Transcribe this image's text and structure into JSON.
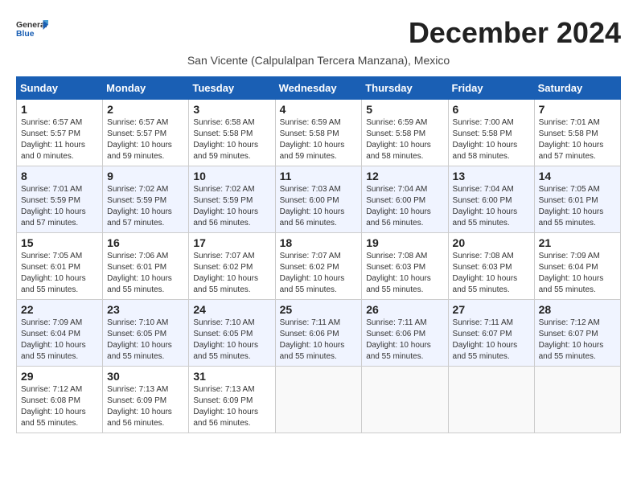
{
  "header": {
    "logo_general": "General",
    "logo_blue": "Blue",
    "month_title": "December 2024",
    "subtitle": "San Vicente (Calpulalpan Tercera Manzana), Mexico"
  },
  "days_of_week": [
    "Sunday",
    "Monday",
    "Tuesday",
    "Wednesday",
    "Thursday",
    "Friday",
    "Saturday"
  ],
  "weeks": [
    [
      {
        "day": "1",
        "info": "Sunrise: 6:57 AM\nSunset: 5:57 PM\nDaylight: 11 hours\nand 0 minutes."
      },
      {
        "day": "2",
        "info": "Sunrise: 6:57 AM\nSunset: 5:57 PM\nDaylight: 10 hours\nand 59 minutes."
      },
      {
        "day": "3",
        "info": "Sunrise: 6:58 AM\nSunset: 5:58 PM\nDaylight: 10 hours\nand 59 minutes."
      },
      {
        "day": "4",
        "info": "Sunrise: 6:59 AM\nSunset: 5:58 PM\nDaylight: 10 hours\nand 59 minutes."
      },
      {
        "day": "5",
        "info": "Sunrise: 6:59 AM\nSunset: 5:58 PM\nDaylight: 10 hours\nand 58 minutes."
      },
      {
        "day": "6",
        "info": "Sunrise: 7:00 AM\nSunset: 5:58 PM\nDaylight: 10 hours\nand 58 minutes."
      },
      {
        "day": "7",
        "info": "Sunrise: 7:01 AM\nSunset: 5:58 PM\nDaylight: 10 hours\nand 57 minutes."
      }
    ],
    [
      {
        "day": "8",
        "info": "Sunrise: 7:01 AM\nSunset: 5:59 PM\nDaylight: 10 hours\nand 57 minutes."
      },
      {
        "day": "9",
        "info": "Sunrise: 7:02 AM\nSunset: 5:59 PM\nDaylight: 10 hours\nand 57 minutes."
      },
      {
        "day": "10",
        "info": "Sunrise: 7:02 AM\nSunset: 5:59 PM\nDaylight: 10 hours\nand 56 minutes."
      },
      {
        "day": "11",
        "info": "Sunrise: 7:03 AM\nSunset: 6:00 PM\nDaylight: 10 hours\nand 56 minutes."
      },
      {
        "day": "12",
        "info": "Sunrise: 7:04 AM\nSunset: 6:00 PM\nDaylight: 10 hours\nand 56 minutes."
      },
      {
        "day": "13",
        "info": "Sunrise: 7:04 AM\nSunset: 6:00 PM\nDaylight: 10 hours\nand 55 minutes."
      },
      {
        "day": "14",
        "info": "Sunrise: 7:05 AM\nSunset: 6:01 PM\nDaylight: 10 hours\nand 55 minutes."
      }
    ],
    [
      {
        "day": "15",
        "info": "Sunrise: 7:05 AM\nSunset: 6:01 PM\nDaylight: 10 hours\nand 55 minutes."
      },
      {
        "day": "16",
        "info": "Sunrise: 7:06 AM\nSunset: 6:01 PM\nDaylight: 10 hours\nand 55 minutes."
      },
      {
        "day": "17",
        "info": "Sunrise: 7:07 AM\nSunset: 6:02 PM\nDaylight: 10 hours\nand 55 minutes."
      },
      {
        "day": "18",
        "info": "Sunrise: 7:07 AM\nSunset: 6:02 PM\nDaylight: 10 hours\nand 55 minutes."
      },
      {
        "day": "19",
        "info": "Sunrise: 7:08 AM\nSunset: 6:03 PM\nDaylight: 10 hours\nand 55 minutes."
      },
      {
        "day": "20",
        "info": "Sunrise: 7:08 AM\nSunset: 6:03 PM\nDaylight: 10 hours\nand 55 minutes."
      },
      {
        "day": "21",
        "info": "Sunrise: 7:09 AM\nSunset: 6:04 PM\nDaylight: 10 hours\nand 55 minutes."
      }
    ],
    [
      {
        "day": "22",
        "info": "Sunrise: 7:09 AM\nSunset: 6:04 PM\nDaylight: 10 hours\nand 55 minutes."
      },
      {
        "day": "23",
        "info": "Sunrise: 7:10 AM\nSunset: 6:05 PM\nDaylight: 10 hours\nand 55 minutes."
      },
      {
        "day": "24",
        "info": "Sunrise: 7:10 AM\nSunset: 6:05 PM\nDaylight: 10 hours\nand 55 minutes."
      },
      {
        "day": "25",
        "info": "Sunrise: 7:11 AM\nSunset: 6:06 PM\nDaylight: 10 hours\nand 55 minutes."
      },
      {
        "day": "26",
        "info": "Sunrise: 7:11 AM\nSunset: 6:06 PM\nDaylight: 10 hours\nand 55 minutes."
      },
      {
        "day": "27",
        "info": "Sunrise: 7:11 AM\nSunset: 6:07 PM\nDaylight: 10 hours\nand 55 minutes."
      },
      {
        "day": "28",
        "info": "Sunrise: 7:12 AM\nSunset: 6:07 PM\nDaylight: 10 hours\nand 55 minutes."
      }
    ],
    [
      {
        "day": "29",
        "info": "Sunrise: 7:12 AM\nSunset: 6:08 PM\nDaylight: 10 hours\nand 55 minutes."
      },
      {
        "day": "30",
        "info": "Sunrise: 7:13 AM\nSunset: 6:09 PM\nDaylight: 10 hours\nand 56 minutes."
      },
      {
        "day": "31",
        "info": "Sunrise: 7:13 AM\nSunset: 6:09 PM\nDaylight: 10 hours\nand 56 minutes."
      },
      {
        "day": "",
        "info": ""
      },
      {
        "day": "",
        "info": ""
      },
      {
        "day": "",
        "info": ""
      },
      {
        "day": "",
        "info": ""
      }
    ]
  ]
}
